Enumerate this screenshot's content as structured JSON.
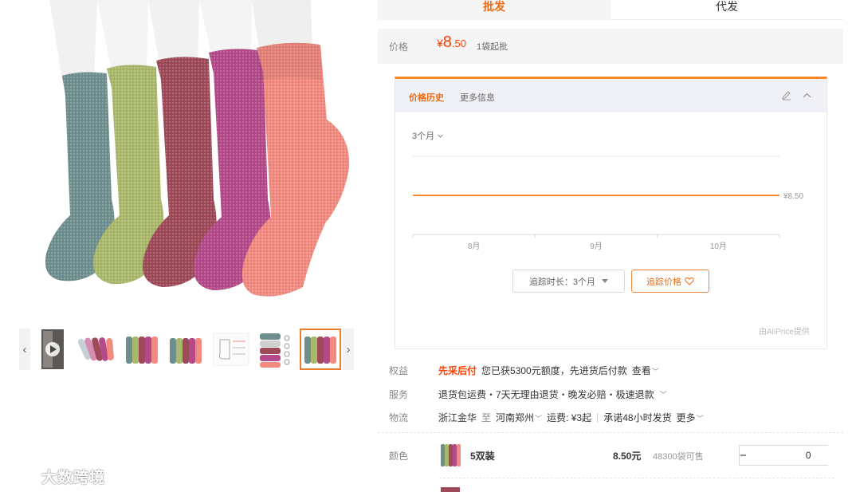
{
  "tabs": {
    "wholesale": "批发",
    "dropship": "代发"
  },
  "price": {
    "label": "价格",
    "currency": "¥",
    "int_part": "8",
    "dec_part": ".50",
    "moq": "1袋起批",
    "color": "#ff4000"
  },
  "history": {
    "tab_active": "价格历史",
    "tab_other": "更多信息",
    "range": "3个月",
    "track_duration": "追踪时长：3个月",
    "track_price": "追踪价格",
    "provider": "由AliPrice提供",
    "accent_color": "#ff8a2b",
    "icons": {
      "edit": "pencil-icon",
      "collapse": "chevron-up-icon",
      "heart": "heart-icon"
    }
  },
  "chart_data": {
    "type": "line",
    "x_ticks": [
      "8月",
      "9月",
      "10月"
    ],
    "series": [
      {
        "values": [
          8.5,
          8.5,
          8.5,
          8.5
        ],
        "color": "#ff8a2b"
      }
    ],
    "end_label": "¥8.50",
    "grid": true
  },
  "info": {
    "rights": {
      "label": "权益",
      "badge": "先采后付",
      "text": "您已获5300元额度，先进货后付款",
      "link": "查看"
    },
    "service": {
      "label": "服务",
      "text": "退货包运费・7天无理由退货・晚发必赔・极速退款"
    },
    "logistics": {
      "label": "物流",
      "from": "浙江金华",
      "to_word": "至",
      "to": "河南郑州",
      "fee": "运费: ¥3起",
      "promise": "承诺48小时发货",
      "more": "更多"
    }
  },
  "sku": {
    "label": "颜色",
    "name": "5双装",
    "price": "8.50元",
    "stock": "48300袋可售",
    "quantity": "0",
    "minus": "−",
    "plus": "+"
  },
  "watermark": "大数跨境",
  "gallery": {
    "prev": "‹",
    "next": "›",
    "sock_colors": [
      "#6f8f8f",
      "#a9b86a",
      "#9e4a58",
      "#b44a8a",
      "#f28a80"
    ]
  }
}
